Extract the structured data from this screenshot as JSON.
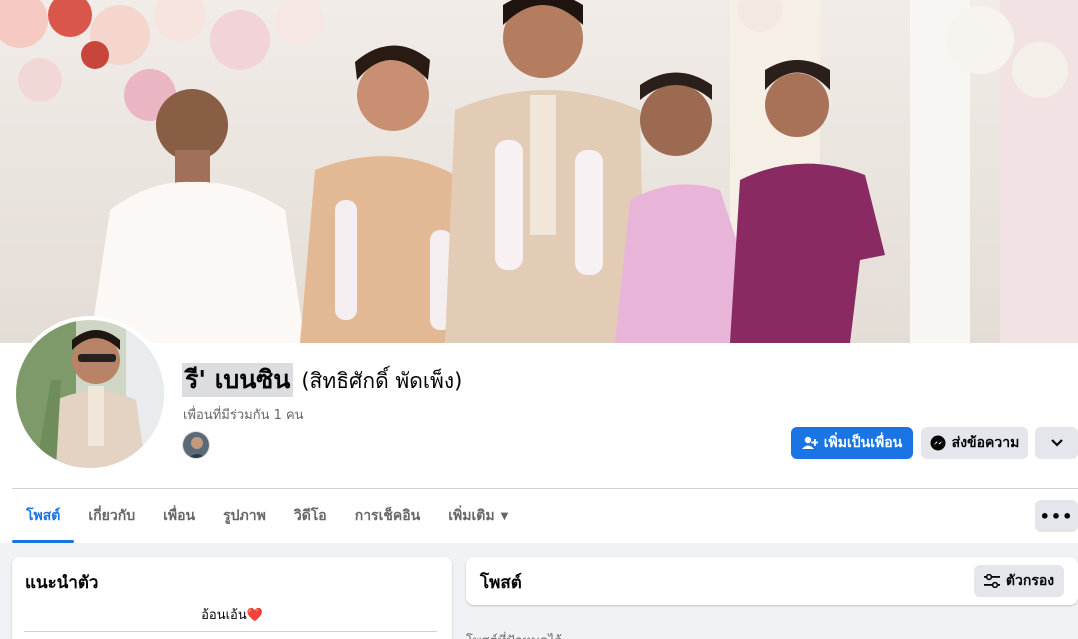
{
  "profile": {
    "name": "รี' เบนซิน",
    "alt_name": "(สิทธิศักดิ์ พัดเพ็ง)",
    "mutual_friends": "เพื่อนที่มีร่วมกัน 1 คน"
  },
  "actions": {
    "add_friend": "เพิ่มเป็นเพื่อน",
    "message": "ส่งข้อความ"
  },
  "tabs": [
    {
      "label": "โพสต์",
      "active": true
    },
    {
      "label": "เกี่ยวกับ"
    },
    {
      "label": "เพื่อน"
    },
    {
      "label": "รูปภาพ"
    },
    {
      "label": "วิดีโอ"
    },
    {
      "label": "การเช็คอิน"
    },
    {
      "label": "เพิ่มเติม"
    }
  ],
  "more_tab_caret": "▼",
  "tabs_more_label": "•••",
  "intro": {
    "title": "แนะนำตัว",
    "bio": "อ้อนเอ้น❤️"
  },
  "posts": {
    "title": "โพสต์",
    "filter_label": "ตัวกรอง",
    "below_text": "โพสต์ที่ปักหมุดไว้"
  },
  "colors": {
    "accent": "#1b74e4",
    "button_gray": "#e4e6eb",
    "page_bg": "#f0f2f5"
  },
  "icons": [
    "add-friend-icon",
    "messenger-icon",
    "chevron-down-icon",
    "more-dots-icon",
    "filter-icon",
    "caret-down-icon"
  ]
}
